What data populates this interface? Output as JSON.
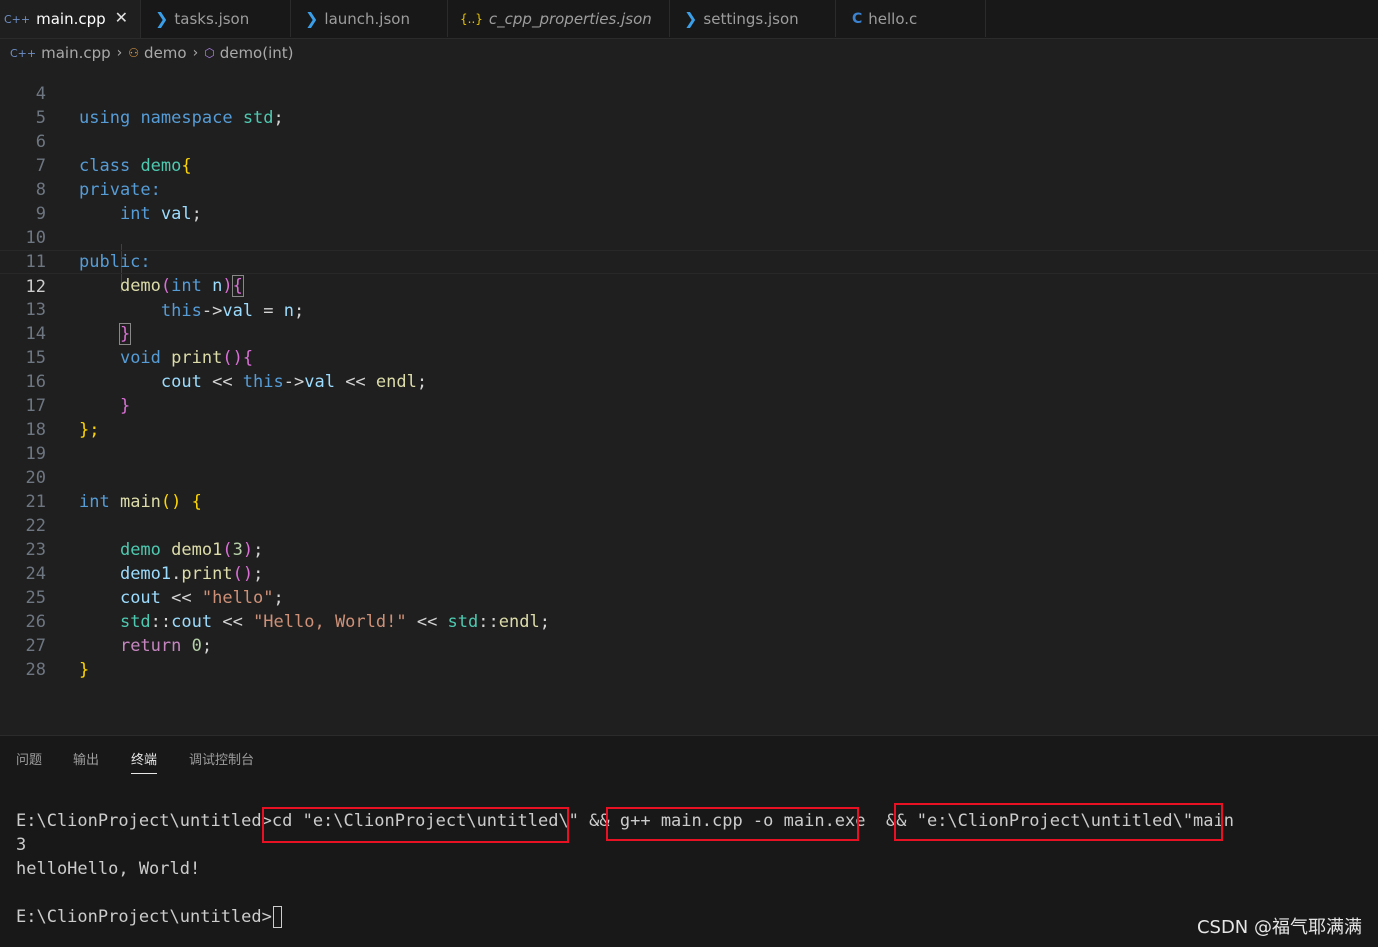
{
  "tabs": [
    {
      "label": "main.cpp",
      "icon": "cpp-file-icon",
      "active": true
    },
    {
      "label": "tasks.json",
      "icon": "vscode-icon"
    },
    {
      "label": "launch.json",
      "icon": "vscode-icon"
    },
    {
      "label": "c_cpp_properties.json",
      "icon": "json-braces-icon"
    },
    {
      "label": "settings.json",
      "icon": "vscode-icon"
    },
    {
      "label": "hello.c",
      "icon": "c-file-icon"
    }
  ],
  "icons": {
    "cpp": "C++",
    "c": "C",
    "json": "{..}",
    "vs": "❯",
    "close": "✕",
    "chev": "›",
    "cls": "⚇",
    "mth": "⬡"
  },
  "breadcrumbs": [
    "main.cpp",
    "demo",
    "demo(int)"
  ],
  "editor": {
    "line_numbers": [
      "4",
      "5",
      "6",
      "7",
      "8",
      "9",
      "10",
      "11",
      "12",
      "13",
      "14",
      "15",
      "16",
      "17",
      "18",
      "19",
      "20",
      "21",
      "22",
      "23",
      "24",
      "25",
      "26",
      "27",
      "28"
    ],
    "current_line": "12",
    "tokens": {
      "using": "using",
      "namespace": "namespace",
      "std": "std",
      "semi": ";",
      "class": "class",
      "demo": "demo",
      "lbrace": "{",
      "rbrace": "}",
      "rbrace_semi": "};",
      "private": "private:",
      "public": "public:",
      "int": "int",
      "val": "val",
      "lparen": "(",
      "rparen": ")",
      "n": "n",
      "this": "this",
      "arrow": "->",
      "assign": " = ",
      "void": "void",
      "print": "print",
      "cout": "cout",
      "shl": " << ",
      "endl": "endl",
      "main": "main",
      "demo1": "demo1",
      "three": "3",
      "dot": ".",
      "hello_str": "\"hello\"",
      "hello_world_str": "\"Hello, World!\"",
      "scope": "::",
      "return": "return",
      "zero": "0",
      "parens": "()"
    }
  },
  "panel": {
    "tabs": [
      "问题",
      "输出",
      "终端",
      "调试控制台"
    ],
    "active_tab": "终端",
    "terminal": {
      "prompt": "E:\\ClionProject\\untitled>",
      "cmd_cd": "cd \"e:\\ClionProject\\untitled\\\"",
      "and": " && ",
      "cmd_gpp": "g++ main.cpp -o main.exe",
      "cmd_run": "\"e:\\ClionProject\\untitled\\\"main",
      "output_line1": "3",
      "output_line2": "helloHello, World!"
    }
  },
  "watermark": "CSDN @福气耶满满"
}
